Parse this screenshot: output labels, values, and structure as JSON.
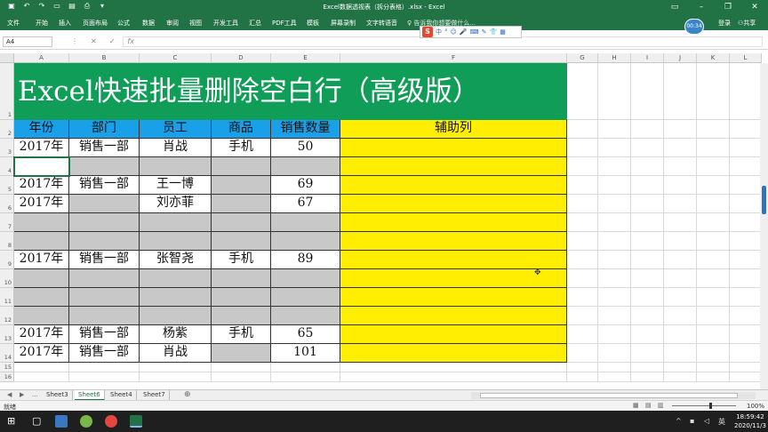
{
  "title_bar": {
    "title": "Excel数据透视表（拆分表格）.xlsx - Excel",
    "window_buttons": [
      "–",
      "❐",
      "✕"
    ]
  },
  "ribbon": {
    "tabs": [
      "文件",
      "开始",
      "插入",
      "页面布局",
      "公式",
      "数据",
      "审阅",
      "视图",
      "开发工具",
      "汇总",
      "PDF工具",
      "模板",
      "屏幕录制",
      "文字转语音"
    ],
    "tell_me": "告诉我你想要做什么...",
    "login": "登录",
    "share": "共享",
    "time_badge": "00:34"
  },
  "ime_toolbar": {
    "logo": "S",
    "items": [
      "中",
      "°",
      "☺",
      "🎤",
      "⌨",
      "✎",
      "👕",
      "▦"
    ]
  },
  "formula_bar": {
    "name_box": "A4",
    "cancel": "✕",
    "enter": "✓",
    "fx": "fx",
    "formula": ""
  },
  "columns": [
    "A",
    "B",
    "C",
    "D",
    "E",
    "F",
    "G",
    "H",
    "I",
    "J",
    "K",
    "L"
  ],
  "rows": [
    "1",
    "2",
    "3",
    "4",
    "5",
    "6",
    "7",
    "8",
    "9",
    "10",
    "11",
    "12",
    "13",
    "14",
    "15",
    "16"
  ],
  "sheet": {
    "banner": "Excel快速批量删除空白行（高级版）",
    "headers": [
      "年份",
      "部门",
      "员工",
      "商品",
      "销售数量",
      "辅助列"
    ],
    "data": [
      [
        "2017年",
        "销售一部",
        "肖战",
        "手机",
        "50"
      ],
      [
        "",
        "",
        "",
        "",
        ""
      ],
      [
        "2017年",
        "销售一部",
        "王一博",
        "",
        "69"
      ],
      [
        "2017年",
        "",
        "刘亦菲",
        "",
        "67"
      ],
      [
        "",
        "",
        "",
        "",
        ""
      ],
      [
        "",
        "",
        "",
        "",
        ""
      ],
      [
        "2017年",
        "销售一部",
        "张智尧",
        "手机",
        "89"
      ],
      [
        "",
        "",
        "",
        "",
        ""
      ],
      [
        "",
        "",
        "",
        "",
        ""
      ],
      [
        "",
        "",
        "",
        "",
        ""
      ],
      [
        "2017年",
        "销售一部",
        "杨紫",
        "手机",
        "65"
      ],
      [
        "2017年",
        "销售一部",
        "肖战",
        "",
        "101"
      ]
    ],
    "gray_cells": [
      [
        1,
        1
      ],
      [
        1,
        2
      ],
      [
        1,
        3
      ],
      [
        1,
        4
      ],
      [
        2,
        3
      ],
      [
        3,
        1
      ],
      [
        3,
        3
      ],
      [
        4,
        0
      ],
      [
        4,
        1
      ],
      [
        4,
        2
      ],
      [
        4,
        3
      ],
      [
        4,
        4
      ],
      [
        5,
        0
      ],
      [
        5,
        1
      ],
      [
        5,
        2
      ],
      [
        5,
        3
      ],
      [
        5,
        4
      ],
      [
        7,
        0
      ],
      [
        7,
        1
      ],
      [
        7,
        2
      ],
      [
        7,
        3
      ],
      [
        7,
        4
      ],
      [
        8,
        0
      ],
      [
        8,
        1
      ],
      [
        8,
        2
      ],
      [
        8,
        3
      ],
      [
        8,
        4
      ],
      [
        9,
        0
      ],
      [
        9,
        1
      ],
      [
        9,
        2
      ],
      [
        9,
        3
      ],
      [
        9,
        4
      ],
      [
        11,
        3
      ]
    ]
  },
  "sheet_tabs": {
    "nav": [
      "◀",
      "▶",
      "..."
    ],
    "tabs": [
      "Sheet3",
      "Sheet6",
      "Sheet4",
      "Sheet7"
    ],
    "active": "Sheet6",
    "add": "⊕"
  },
  "status_bar": {
    "ready": "就绪",
    "zoom": "100%"
  },
  "taskbar": {
    "time": "18:59:42",
    "date": "2020/11/3",
    "lang": "英"
  },
  "colors": {
    "excel_green": "#217346",
    "banner_green": "#0f9d58",
    "header_blue": "#1aa0e8",
    "helper_yellow": "#ffee00",
    "empty_gray": "#c8c8c8"
  }
}
